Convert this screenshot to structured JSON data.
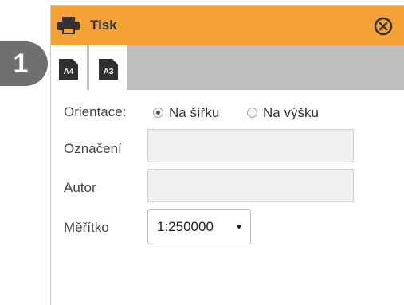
{
  "window": {
    "title": "Tisk",
    "print_icon": "printer-icon",
    "close_icon": "close-circle-icon"
  },
  "step_badge": "1",
  "formats": [
    {
      "label": "A4"
    },
    {
      "label": "A3"
    }
  ],
  "orientation": {
    "label": "Orientace:",
    "options": [
      {
        "label": "Na šířku",
        "selected": true
      },
      {
        "label": "Na výšku",
        "selected": false
      }
    ]
  },
  "fields": {
    "designation_label": "Označení",
    "designation_value": "",
    "author_label": "Autor",
    "author_value": ""
  },
  "scale": {
    "label": "Měřítko",
    "selected": "1:250000"
  },
  "colors": {
    "titlebar": "#f4a236",
    "toolbar": "#bdbdbd",
    "badge": "#6f6f6f"
  }
}
